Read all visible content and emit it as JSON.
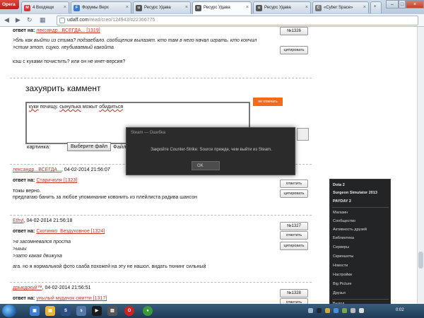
{
  "browser": {
    "menu_label": "Opera",
    "tabs": [
      {
        "label": "Входящи",
        "favicon": "gmail-icon",
        "fav_text": "M",
        "fav_color": "#d33"
      },
      {
        "label": "Форумы Верх",
        "favicon": "forum-icon",
        "fav_text": "F",
        "fav_color": "#3b7bd4"
      },
      {
        "label": "Ресурс Удава",
        "favicon": "site-icon",
        "fav_text": "u",
        "fav_color": "#555"
      },
      {
        "label": "Ресурс Удава",
        "favicon": "site-icon",
        "fav_text": "u",
        "fav_color": "#555",
        "active": true
      },
      {
        "label": "Ресурс Удава",
        "favicon": "site-icon",
        "fav_text": "u",
        "fav_color": "#555"
      },
      {
        "label": "«Cyber Space»",
        "favicon": "site-icon",
        "fav_text": "C",
        "fav_color": "#777"
      }
    ],
    "unread_badge": "4",
    "url_host": "udaff.com",
    "url_path": "/read/creo/124943/#22366775"
  },
  "posts": [
    {
      "reply_label": "ответ на:",
      "reply_to": "лександр...ВСЕГДА... [1319]",
      "number": "№1326",
      "quotes": [
        ">бль как выйти из стима? подзаебало. сообщения вылазят. кто там в него начал играть. кто кончил",
        ">стим этот. сцуко. неубиваемый какойта"
      ],
      "text": "кэш с куками почистить? или он не инет-версия?",
      "quote_button": "цитировать"
    },
    {
      "author": "лександр...ВСЕГДА...",
      "date": ", 04-02-2014 21:56:07",
      "reply_label": "ответ на:",
      "reply_to": "Старичюля [1323]",
      "text": "тожы верно.",
      "text2": "предлагаю банить за любое упоминание ковонить из плейлиста радива шансон",
      "answer_button": "ответить",
      "quote_button": "цитировать"
    },
    {
      "author": "Ethyl",
      "date": ", 04-02-2014 21:56:18",
      "reply_label": "ответ на:",
      "reply_to": "Скотинко_Бездуховное [1324]",
      "number": "№1327",
      "quotes": [
        ">я засомневался проста",
        ">ыыы",
        ">зато какая движуха"
      ],
      "text": "ага. но я нормальной фото сааба похожей на эту не нашол. видать тюнинг сильный",
      "answer_button": "ответить",
      "quote_button": "цитировать"
    },
    {
      "author": "дрыкдокуй™",
      "date": ", 04-02-2014 21:56:51",
      "reply_label": "ответ на:",
      "reply_to": "унылый мудачок смитти [1317]",
      "number": "№1328",
      "answer_button": "ответить"
    }
  ],
  "comment_form": {
    "title": "захуярить каммент",
    "text_before": "куки",
    "text_mid": " почищу. ",
    "text_spell": "сынулька",
    "text_after": " можыт ",
    "text_spell2": "обидиться",
    "send_label": "не отвечать",
    "picture_label": "картинка:",
    "file_button": "Выберите файл",
    "file_name": "Файл"
  },
  "steam_dialog": {
    "title": "Steam — Ошибка",
    "message": "Закройте Counter-Strike: Source прежде, чем выйти из Steam.",
    "ok_label": "OK"
  },
  "steam_menu": {
    "games": [
      "Dota 2",
      "Surgeon Simulator 2013",
      "PAYDAY 2"
    ],
    "items": [
      "Магазин",
      "Сообщество",
      "Активность друзей",
      "Библиотека",
      "Серверы",
      "Скриншоты",
      "Новости",
      "Настройки",
      "Big Picture",
      "Друзья",
      "Выход"
    ]
  },
  "taskbar": {
    "clock": "0:02"
  }
}
